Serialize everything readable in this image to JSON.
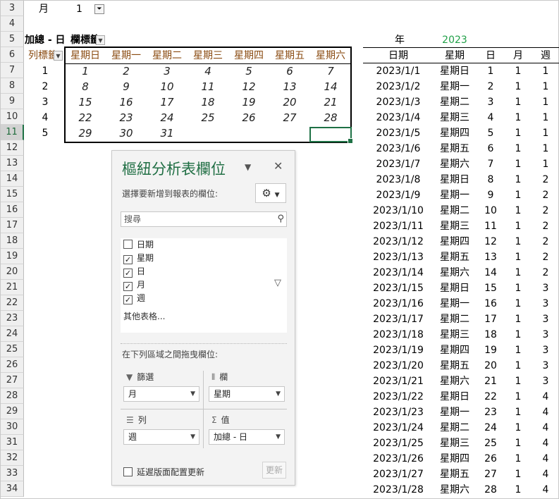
{
  "rows": [
    "3",
    "4",
    "5",
    "6",
    "7",
    "8",
    "9",
    "10",
    "11",
    "12",
    "13",
    "14",
    "15",
    "16",
    "17",
    "18",
    "19",
    "20",
    "21",
    "22",
    "23",
    "24",
    "25",
    "26",
    "27",
    "28",
    "29",
    "30",
    "31",
    "32",
    "33",
    "34"
  ],
  "pivot": {
    "filter_label": "月",
    "filter_value": "1",
    "values_header": "加總 - 日",
    "col_labels_header": "欄標籤",
    "row_labels_header": "列標籤",
    "weekdays": [
      "星期日",
      "星期一",
      "星期二",
      "星期三",
      "星期四",
      "星期五",
      "星期六"
    ],
    "week_numbers": [
      "1",
      "2",
      "3",
      "4",
      "5"
    ],
    "calendar": [
      [
        "1",
        "2",
        "3",
        "4",
        "5",
        "6",
        "7"
      ],
      [
        "8",
        "9",
        "10",
        "11",
        "12",
        "13",
        "14"
      ],
      [
        "15",
        "16",
        "17",
        "18",
        "19",
        "20",
        "21"
      ],
      [
        "22",
        "23",
        "24",
        "25",
        "26",
        "27",
        "28"
      ],
      [
        "29",
        "30",
        "31",
        "",
        "",
        "",
        ""
      ]
    ]
  },
  "table": {
    "year_label": "年",
    "year_value": "2023",
    "headers": [
      "日期",
      "星期",
      "日",
      "月",
      "週"
    ],
    "rows": [
      [
        "2023/1/1",
        "星期日",
        "1",
        "1",
        "1"
      ],
      [
        "2023/1/2",
        "星期一",
        "2",
        "1",
        "1"
      ],
      [
        "2023/1/3",
        "星期二",
        "3",
        "1",
        "1"
      ],
      [
        "2023/1/4",
        "星期三",
        "4",
        "1",
        "1"
      ],
      [
        "2023/1/5",
        "星期四",
        "5",
        "1",
        "1"
      ],
      [
        "2023/1/6",
        "星期五",
        "6",
        "1",
        "1"
      ],
      [
        "2023/1/7",
        "星期六",
        "7",
        "1",
        "1"
      ],
      [
        "2023/1/8",
        "星期日",
        "8",
        "1",
        "2"
      ],
      [
        "2023/1/9",
        "星期一",
        "9",
        "1",
        "2"
      ],
      [
        "2023/1/10",
        "星期二",
        "10",
        "1",
        "2"
      ],
      [
        "2023/1/11",
        "星期三",
        "11",
        "1",
        "2"
      ],
      [
        "2023/1/12",
        "星期四",
        "12",
        "1",
        "2"
      ],
      [
        "2023/1/13",
        "星期五",
        "13",
        "1",
        "2"
      ],
      [
        "2023/1/14",
        "星期六",
        "14",
        "1",
        "2"
      ],
      [
        "2023/1/15",
        "星期日",
        "15",
        "1",
        "3"
      ],
      [
        "2023/1/16",
        "星期一",
        "16",
        "1",
        "3"
      ],
      [
        "2023/1/17",
        "星期二",
        "17",
        "1",
        "3"
      ],
      [
        "2023/1/18",
        "星期三",
        "18",
        "1",
        "3"
      ],
      [
        "2023/1/19",
        "星期四",
        "19",
        "1",
        "3"
      ],
      [
        "2023/1/20",
        "星期五",
        "20",
        "1",
        "3"
      ],
      [
        "2023/1/21",
        "星期六",
        "21",
        "1",
        "3"
      ],
      [
        "2023/1/22",
        "星期日",
        "22",
        "1",
        "4"
      ],
      [
        "2023/1/23",
        "星期一",
        "23",
        "1",
        "4"
      ],
      [
        "2023/1/24",
        "星期二",
        "24",
        "1",
        "4"
      ],
      [
        "2023/1/25",
        "星期三",
        "25",
        "1",
        "4"
      ],
      [
        "2023/1/26",
        "星期四",
        "26",
        "1",
        "4"
      ],
      [
        "2023/1/27",
        "星期五",
        "27",
        "1",
        "4"
      ],
      [
        "2023/1/28",
        "星期六",
        "28",
        "1",
        "4"
      ]
    ]
  },
  "pane": {
    "title": "樞紐分析表欄位",
    "subtitle": "選擇要新增到報表的欄位:",
    "search_placeholder": "搜尋",
    "fields": [
      {
        "label": "日期",
        "checked": false
      },
      {
        "label": "星期",
        "checked": true
      },
      {
        "label": "日",
        "checked": true
      },
      {
        "label": "月",
        "checked": true
      },
      {
        "label": "週",
        "checked": true
      }
    ],
    "more_tables": "其他表格...",
    "drag_text": "在下列區域之間拖曳欄位:",
    "areas": {
      "filters_label": "篩選",
      "filters_value": "月",
      "columns_label": "欄",
      "columns_value": "星期",
      "rows_label": "列",
      "rows_value": "週",
      "values_label": "值",
      "values_value": "加總 - 日"
    },
    "defer_label": "延遲版面配置更新",
    "update_button": "更新"
  },
  "colors": {
    "accent_green": "#1e7145",
    "year_green": "#21a048",
    "header_brown": "#8a4b11"
  },
  "icons": [
    "filter-dropdown-icon",
    "dropdown-icon",
    "gear-icon",
    "search-icon",
    "funnel-icon",
    "close-icon",
    "pin-dropdown-icon",
    "checkbox-icon",
    "filter-area-icon",
    "column-area-icon",
    "row-area-icon",
    "sigma-icon"
  ]
}
